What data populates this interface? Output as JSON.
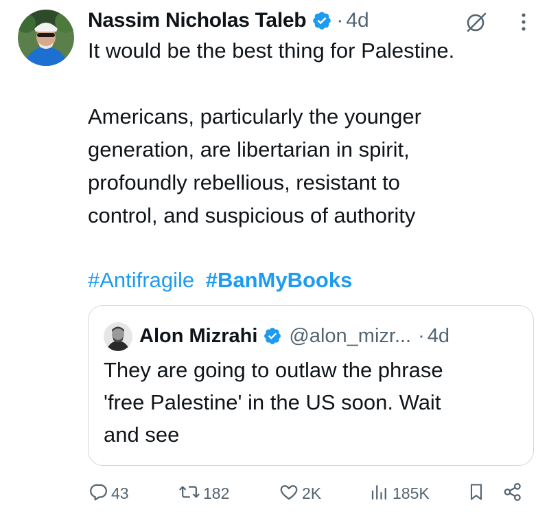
{
  "author": {
    "name": "Nassim Nicholas Taleb",
    "time": "4d",
    "separator": "·"
  },
  "tweet": {
    "paragraph1": "It would be the best thing for Palestine.",
    "paragraph2": "Americans, particularly the younger\ngeneration, are libertarian in spirit,\nprofoundly rebellious, resistant to\ncontrol, and suspicious of authority",
    "hashtags": [
      "#Antifragile",
      "#BanMyBooks"
    ]
  },
  "quoted": {
    "name": "Alon Mizrahi",
    "handle": "@alon_mizr...",
    "separator": "·",
    "time": "4d",
    "text": "They are going to outlaw the phrase\n'free Palestine' in the US soon. Wait\nand see"
  },
  "actions": {
    "replies": "43",
    "reposts": "182",
    "likes": "2K",
    "views": "185K"
  },
  "colors": {
    "accent": "#1d9bf0",
    "text": "#0f1419",
    "muted": "#536471",
    "border": "#cfd9de"
  },
  "icons": {
    "verified": "verified-badge-icon",
    "grok": "grok-icon",
    "more": "more-vertical-icon",
    "reply": "reply-icon",
    "repost": "repost-icon",
    "like": "heart-icon",
    "views": "views-chart-icon",
    "bookmark": "bookmark-icon",
    "share": "share-icon"
  }
}
